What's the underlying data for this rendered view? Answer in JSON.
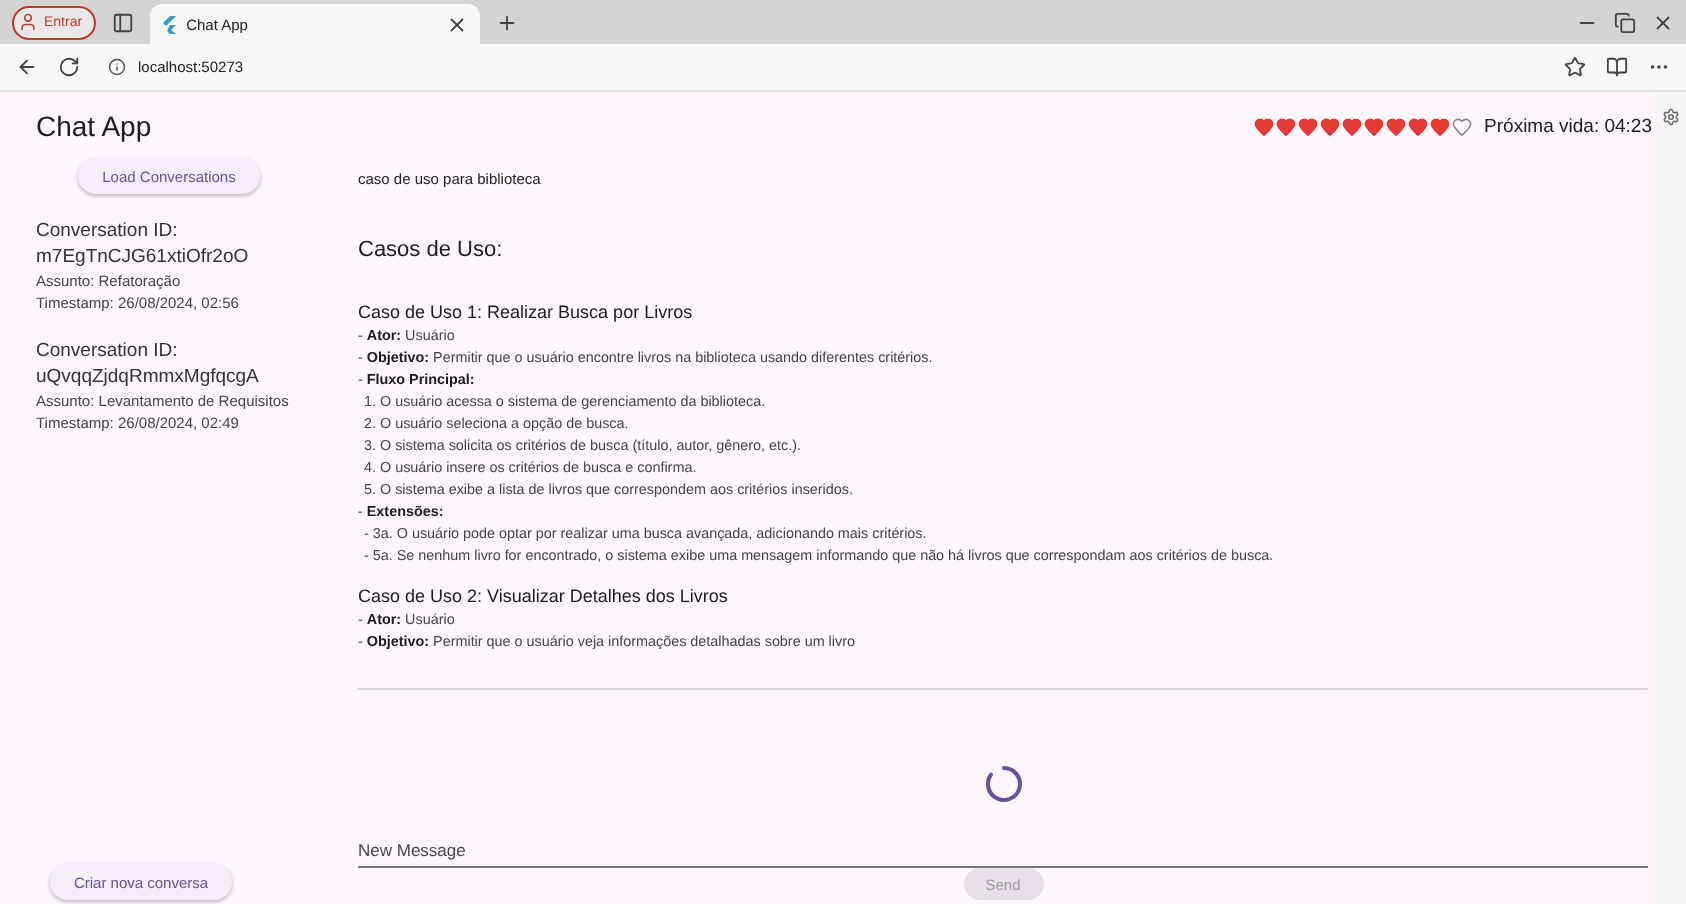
{
  "browser": {
    "profile_label": "Entrar",
    "tab_title": "Chat App",
    "address": "localhost:50273"
  },
  "app": {
    "title": "Chat App",
    "lives": [
      {
        "filled": true
      },
      {
        "filled": true
      },
      {
        "filled": true
      },
      {
        "filled": true
      },
      {
        "filled": true
      },
      {
        "filled": true
      },
      {
        "filled": true
      },
      {
        "filled": true
      },
      {
        "filled": true
      },
      {
        "filled": false
      }
    ],
    "next_life": "Próxima vida: 04:23"
  },
  "sidebar": {
    "load_button": "Load Conversations",
    "conversations": [
      {
        "id_label": "Conversation ID:",
        "id": "m7EgTnCJG61xtiOfr2oO",
        "subject": "Assunto: Refatoração",
        "timestamp": "Timestamp: 26/08/2024, 02:56"
      },
      {
        "id_label": "Conversation ID:",
        "id": "uQvqqZjdqRmmxMgfqcgA",
        "subject": "Assunto: Levantamento de Requisitos",
        "timestamp": "Timestamp: 26/08/2024, 02:49"
      }
    ],
    "new_button": "Criar nova conversa"
  },
  "chat": {
    "messages": [
      {
        "kind": "user",
        "text": "caso de uso para biblioteca"
      },
      {
        "kind": "assistant",
        "lines": [
          {
            "kind": "heading",
            "text": "Casos de Uso:"
          },
          {
            "kind": "title",
            "text": "Caso de Uso 1: Realizar Busca por Livros"
          },
          {
            "kind": "field",
            "text": "- **Ator:** Usuário"
          },
          {
            "kind": "field",
            "text": "- **Objetivo:** Permitir que o usuário encontre livros na biblioteca usando diferentes critérios."
          },
          {
            "kind": "field",
            "text": "- **Fluxo Principal:**"
          },
          {
            "kind": "step",
            "text": "1. O usuário acessa o sistema de gerenciamento da biblioteca."
          },
          {
            "kind": "step",
            "text": "2. O usuário seleciona a opção de busca."
          },
          {
            "kind": "step",
            "text": "3. O sistema solicita os critérios de busca (título, autor, gênero, etc.)."
          },
          {
            "kind": "step",
            "text": "4. O usuário insere os critérios de busca e confirma."
          },
          {
            "kind": "step",
            "text": "5. O sistema exibe a lista de livros que correspondem aos critérios inseridos."
          },
          {
            "kind": "field",
            "text": "- **Extensões:**"
          },
          {
            "kind": "step",
            "text": "- 3a. O usuário pode optar por realizar uma busca avançada, adicionando mais critérios."
          },
          {
            "kind": "step",
            "text": "- 5a. Se nenhum livro for encontrado, o sistema exibe uma mensagem informando que não há livros que correspondam aos critérios de busca."
          },
          {
            "kind": "title",
            "text": "Caso de Uso 2: Visualizar Detalhes dos Livros"
          },
          {
            "kind": "field",
            "text": "- **Ator:** Usuário"
          },
          {
            "kind": "field",
            "text": "- **Objetivo:** Permitir que o usuário veja informações detalhadas sobre um livro"
          }
        ]
      }
    ],
    "loading": true,
    "input": {
      "placeholder": "New Message"
    },
    "send_button": {
      "label": "Send",
      "disabled": true
    }
  }
}
